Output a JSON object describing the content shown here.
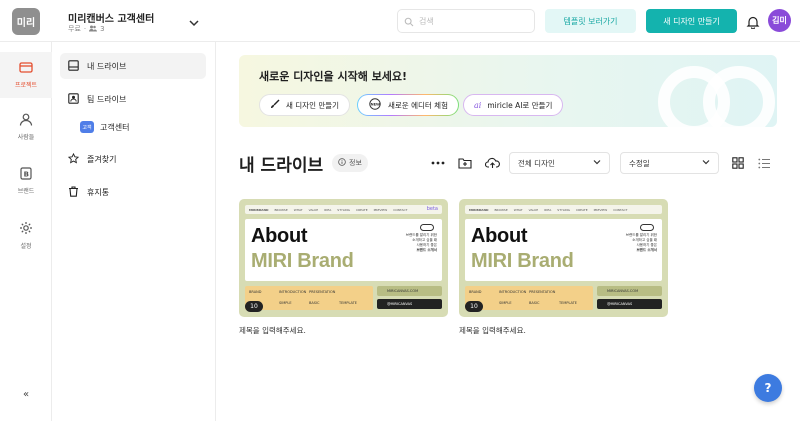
{
  "header": {
    "logo_text": "미리",
    "workspace_name": "미리캔버스 고객센터",
    "plan": "무료",
    "member_count": "3",
    "search_placeholder": "검색",
    "template_button": "템플릿 보러가기",
    "new_design_button": "새 디자인 만들기",
    "avatar_text": "김미"
  },
  "rail": {
    "items": [
      {
        "label": "프로젝트",
        "icon": "folder-icon",
        "active": true
      },
      {
        "label": "사람들",
        "icon": "people-icon"
      },
      {
        "label": "브랜드",
        "icon": "brand-icon"
      },
      {
        "label": "설정",
        "icon": "gear-icon"
      }
    ],
    "collapse": "«"
  },
  "sidebar": {
    "my_drive": "내 드라이브",
    "team_drive": "팀 드라이브",
    "team_badge": "고객",
    "team_name": "고객센터",
    "favorites": "즐겨찾기",
    "trash": "휴지통"
  },
  "banner": {
    "title": "새로운 디자인을 시작해 보세요!",
    "pill_new_design": "새 디자인 만들기",
    "pill_new_editor": "새로운 에디터 체험",
    "pill_editor_badge": "NEW",
    "pill_ai": "miricle AI로 만들기"
  },
  "drive": {
    "title": "내 드라이브",
    "info": "정보",
    "filter_select": "전체 디자인",
    "sort_select": "수정일"
  },
  "cards": [
    {
      "nav_brand": "MIRIBRAND",
      "nav_items": [
        "BROWSE",
        "WHAT",
        "VALUE",
        "IDEA",
        "STYLING",
        "CREATE",
        "PREVIEW",
        "CONTACT"
      ],
      "beta": "beta",
      "headline1": "About",
      "headline2": "MIRI Brand",
      "side_text1": "브랜드를 알리기 위한",
      "side_text2": "소개하고 싶을 때",
      "side_text3": "사용하기 좋은",
      "side_text4": "브랜드 소개서",
      "grid": [
        "BRAND",
        "INTRODUCTION",
        "PRESENTATION",
        "",
        "",
        "SIMPLE",
        "BASIC",
        "TEMPLATE"
      ],
      "bar1": "MIRICANVAS.COM",
      "bar2": "@MIRICANVAS",
      "page_count": "10",
      "title": "제목을 입력해주세요."
    },
    {
      "nav_brand": "MIRIBRAND",
      "nav_items": [
        "BROWSE",
        "WHAT",
        "VALUE",
        "IDEA",
        "STYLING",
        "CREATE",
        "PREVIEW",
        "CONTACT"
      ],
      "beta": "",
      "headline1": "About",
      "headline2": "MIRI Brand",
      "side_text1": "브랜드를 알리기 위한",
      "side_text2": "소개하고 싶을 때",
      "side_text3": "사용하기 좋은",
      "side_text4": "브랜드 소개서",
      "grid": [
        "BRAND",
        "INTRODUCTION",
        "PRESENTATION",
        "",
        "",
        "SIMPLE",
        "BASIC",
        "TEMPLATE"
      ],
      "bar1": "MIRICANVAS.COM",
      "bar2": "@MIRICANVAS",
      "page_count": "10",
      "title": "제목을 입력해주세요."
    }
  ],
  "help": "?",
  "colors": {
    "accent": "#14b3ae",
    "accent_light": "#e3f7f6",
    "rail_active": "#e44d2e",
    "avatar": "#8a4bd9",
    "help_fab": "#3d7be0"
  }
}
